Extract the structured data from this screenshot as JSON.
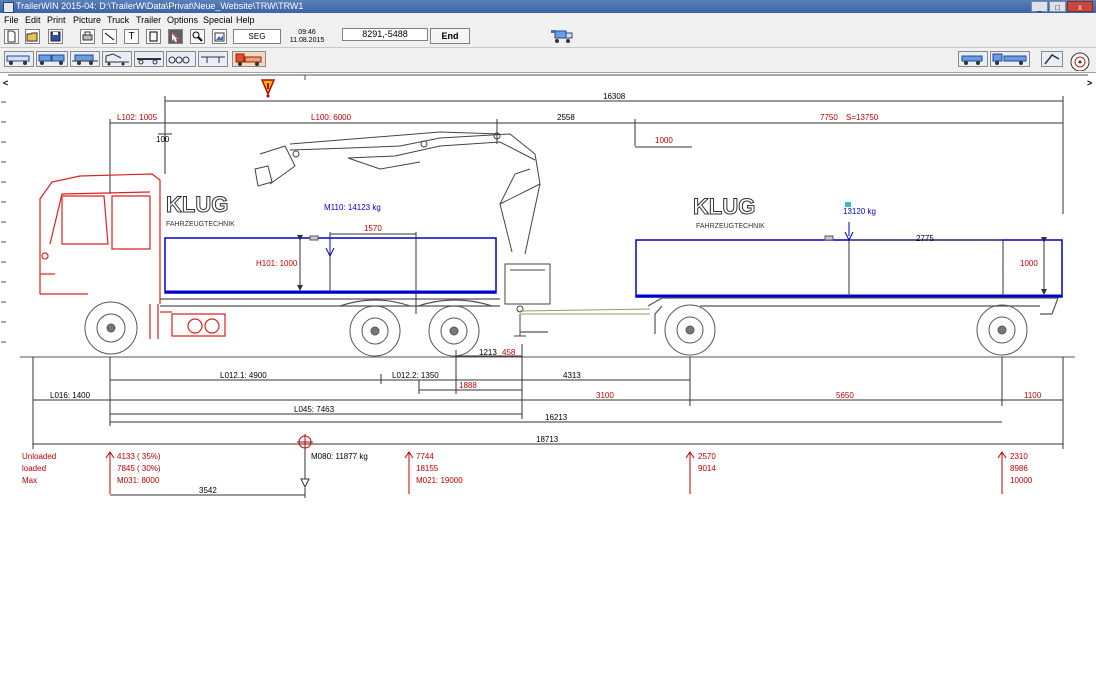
{
  "window": {
    "title": "TrailerWIN 2015-04:  D:\\TrailerW\\Data\\Privat\\Neue_Website\\TRW\\TRW1",
    "min_glyph": "_",
    "max_glyph": "□",
    "close_glyph": "x"
  },
  "menu": {
    "file": "File",
    "edit": "Edit",
    "print": "Print",
    "picture": "Picture",
    "truck": "Truck",
    "trailer": "Trailer",
    "options": "Options",
    "special": "Special",
    "help": "Help"
  },
  "toolbar": {
    "text_tool_glyph": "T",
    "seg_label": "SEG",
    "time": "09:46",
    "date": "11.08.2015",
    "coords": "8291,-5488",
    "end_label": "End",
    "scroll_left": "<",
    "scroll_right": ">"
  },
  "drawing": {
    "total_top": "16308",
    "l102": "L102: 1005",
    "l100": "L100: 6000",
    "crane_gap": "2558",
    "trailer_span": "7750",
    "s_total": "S=13750",
    "dim_100": "100",
    "dim_1000_top": "1000",
    "brand1": "KLUG",
    "brand1_sub": "FAHRZEUGTECHNIK",
    "brand2": "KLUG",
    "brand2_sub": "FAHRZEUGTECHNIK",
    "m110": "M110: 14123 kg",
    "dim_1570": "1570",
    "h101": "H101: 1000",
    "trailer_load": "13120 kg",
    "dim_2775": "2775",
    "trailer_h": "1000",
    "dim_1213": "1213",
    "dim_458": "458",
    "l0121": "L012.1: 4900",
    "l0122": "L012.2: 1350",
    "dim_4313": "4313",
    "dim_1888": "1888",
    "l016": "L016: 1400",
    "dim_3100": "3100",
    "dim_5650": "5650",
    "dim_1100": "1100",
    "l045": "L045: 7463",
    "dim_16213": "16213",
    "dim_18713": "18713"
  },
  "loads": {
    "row_unloaded": "Unloaded",
    "row_loaded": "loaded",
    "row_max": "Max",
    "front_unloaded": "4133 ( 35%)",
    "front_loaded": "7845 ( 30%)",
    "front_max": "M031: 8000",
    "cog": "M080: 11877 kg",
    "cog_dist": "3542",
    "rear_unloaded": "7744",
    "rear_loaded": "18155",
    "rear_max": "M021: 19000",
    "tr1_unloaded": "2570",
    "tr1_loaded": "9014",
    "tr2_unloaded": "2310",
    "tr2_loaded": "8986",
    "tr2_max": "10000"
  },
  "colors": {
    "title_bar": "#3a63a6",
    "dimension": "#c00000",
    "body_outline": "#0000cc",
    "truck_cab": "#e02020",
    "chassis": "#555555",
    "warning": "#f0c000"
  }
}
